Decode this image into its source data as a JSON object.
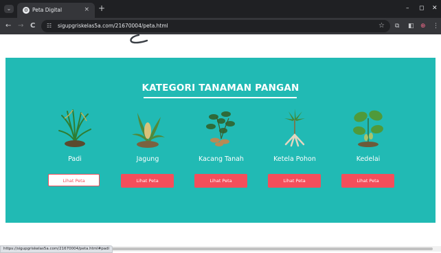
{
  "browser": {
    "tab_title": "Peta Digital",
    "tab_close": "×",
    "new_tab": "+",
    "url": "sigupgriskelas5a.com/21670004/peta.html",
    "status_url": "https://sigupgriskelas5a.com/21670004/peta.html#padi",
    "window_controls": [
      "–",
      "◻",
      "✕"
    ],
    "nav": {
      "back": "←",
      "forward": "→",
      "reload": "C"
    },
    "icons": [
      "site-info-icon",
      "star-icon",
      "extensions-icon",
      "side-panel-icon",
      "profile-icon",
      "menu-icon"
    ]
  },
  "page": {
    "section_title": "KATEGORI TANAMAN PANGAN",
    "crops": [
      {
        "name": "Padi",
        "button": "Lihat Peta",
        "active": true
      },
      {
        "name": "Jagung",
        "button": "Lihat Peta",
        "active": false
      },
      {
        "name": "Kacang Tanah",
        "button": "Lihat Peta",
        "active": false
      },
      {
        "name": "Ketela Pohon",
        "button": "Lihat Peta",
        "active": false
      },
      {
        "name": "Kedelai",
        "button": "Lihat Peta",
        "active": false
      }
    ]
  },
  "colors": {
    "banner": "#21bab4",
    "button": "#f44e5b",
    "text_on_banner": "#ffffff"
  }
}
